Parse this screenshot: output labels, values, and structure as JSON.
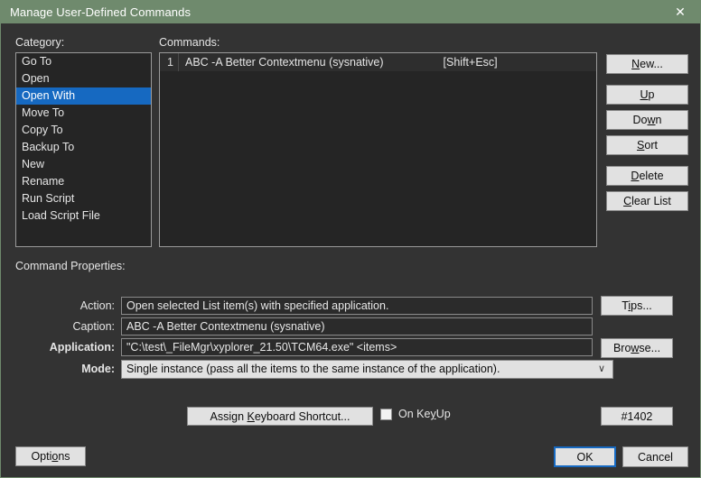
{
  "window": {
    "title": "Manage User-Defined Commands",
    "close_icon": "close-icon"
  },
  "category": {
    "label": "Category:",
    "items": [
      {
        "label": "Go To",
        "selected": false
      },
      {
        "label": "Open",
        "selected": false
      },
      {
        "label": "Open With",
        "selected": true
      },
      {
        "label": "Move To",
        "selected": false
      },
      {
        "label": "Copy To",
        "selected": false
      },
      {
        "label": "Backup To",
        "selected": false
      },
      {
        "label": "New",
        "selected": false
      },
      {
        "label": "Rename",
        "selected": false
      },
      {
        "label": "Run Script",
        "selected": false
      },
      {
        "label": "Load Script File",
        "selected": false
      }
    ]
  },
  "commands": {
    "label": "Commands:",
    "rows": [
      {
        "index": "1",
        "name": "ABC -A Better Contextmenu (sysnative)",
        "shortcut": "[Shift+Esc]"
      }
    ]
  },
  "list_buttons": {
    "new": {
      "pre": "",
      "accel": "N",
      "post": "ew..."
    },
    "up": {
      "pre": "",
      "accel": "U",
      "post": "p"
    },
    "down": {
      "pre": "Do",
      "accel": "w",
      "post": "n"
    },
    "sort": {
      "pre": "",
      "accel": "S",
      "post": "ort"
    },
    "delete": {
      "pre": "",
      "accel": "D",
      "post": "elete"
    },
    "clear_list": {
      "pre": "",
      "accel": "C",
      "post": "lear List"
    }
  },
  "properties": {
    "section_label": "Command Properties:",
    "action": {
      "label": "Action:",
      "value": "Open selected List item(s) with specified application."
    },
    "caption": {
      "label": "Caption:",
      "value": "ABC -A Better Contextmenu (sysnative)"
    },
    "application": {
      "label": "Application:",
      "value": "\"C:\\test\\_FileMgr\\xyplorer_21.50\\TCM64.exe\" <items>"
    },
    "mode": {
      "label": "Mode:",
      "value": "Single instance (pass all the items to the same instance of the application).",
      "chevron": "∨"
    },
    "tips": {
      "pre": "T",
      "accel": "i",
      "post": "ps..."
    },
    "browse": {
      "pre": "Bro",
      "accel": "w",
      "post": "se..."
    }
  },
  "footer": {
    "assign_shortcut": {
      "pre": "Assign ",
      "accel": "K",
      "post": "eyboard Shortcut..."
    },
    "on_keyup": {
      "label_pre": "On Ke",
      "accel": "y",
      "label_post": "Up",
      "checked": false
    },
    "id_badge": "#1402",
    "options": {
      "pre": "Opti",
      "accel": "o",
      "post": "ns"
    },
    "ok": "OK",
    "cancel": "Cancel"
  }
}
